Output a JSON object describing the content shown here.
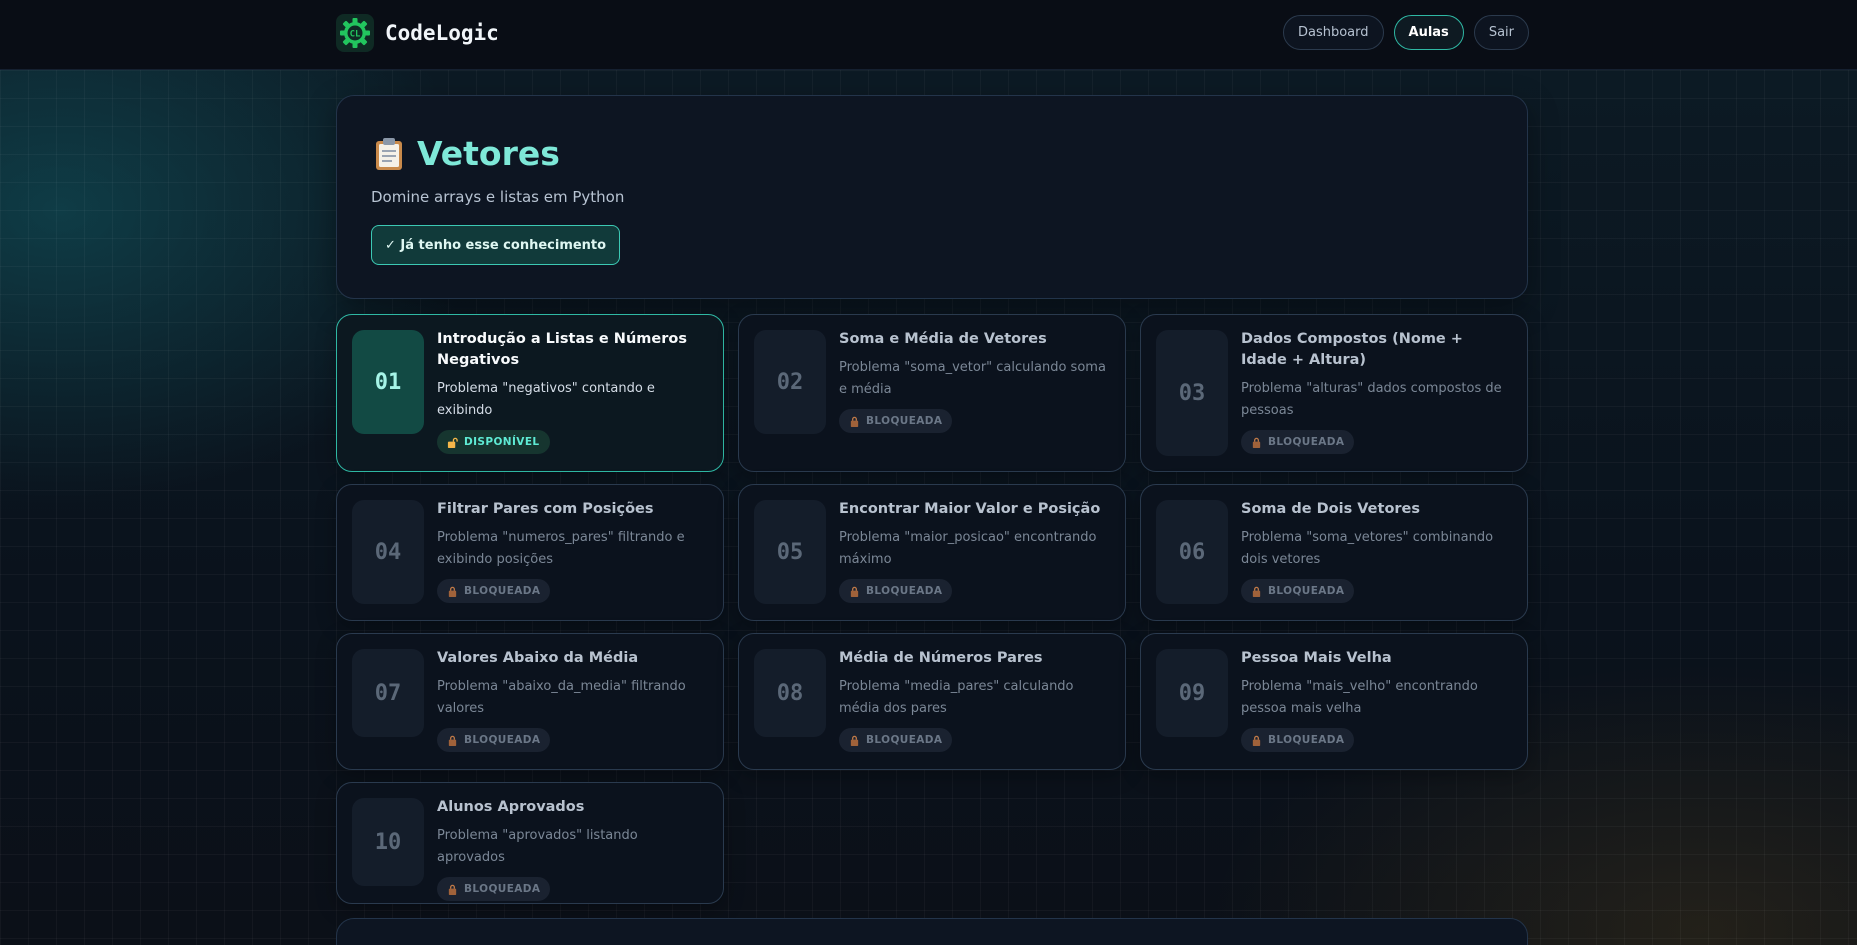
{
  "header": {
    "brand": "CodeLogic",
    "logo_glyph": "CL",
    "nav": [
      {
        "label": "Dashboard",
        "active": false
      },
      {
        "label": "Aulas",
        "active": true
      },
      {
        "label": "Sair",
        "active": false
      }
    ]
  },
  "hero": {
    "icon": "clipboard-icon",
    "title": "Vetores",
    "subtitle": "Domine arrays e listas em Python",
    "known_button": "✓ Já tenho esse conhecimento"
  },
  "lessons": [
    {
      "number": "01",
      "title": "Introdução a Listas e Números Negativos",
      "description": "Problema \"negativos\" contando e exibindo",
      "status": "DISPONÍVEL",
      "available": true
    },
    {
      "number": "02",
      "title": "Soma e Média de Vetores",
      "description": "Problema \"soma_vetor\" calculando soma e média",
      "status": "BLOQUEADA",
      "available": false
    },
    {
      "number": "03",
      "title": "Dados Compostos (Nome + Idade + Altura)",
      "description": "Problema \"alturas\" dados compostos de pessoas",
      "status": "BLOQUEADA",
      "available": false
    },
    {
      "number": "04",
      "title": "Filtrar Pares com Posições",
      "description": "Problema \"numeros_pares\" filtrando e exibindo posições",
      "status": "BLOQUEADA",
      "available": false
    },
    {
      "number": "05",
      "title": "Encontrar Maior Valor e Posição",
      "description": "Problema \"maior_posicao\" encontrando máximo",
      "status": "BLOQUEADA",
      "available": false
    },
    {
      "number": "06",
      "title": "Soma de Dois Vetores",
      "description": "Problema \"soma_vetores\" combinando dois vetores",
      "status": "BLOQUEADA",
      "available": false
    },
    {
      "number": "07",
      "title": "Valores Abaixo da Média",
      "description": "Problema \"abaixo_da_media\" filtrando valores",
      "status": "BLOQUEADA",
      "available": false
    },
    {
      "number": "08",
      "title": "Média de Números Pares",
      "description": "Problema \"media_pares\" calculando média dos pares",
      "status": "BLOQUEADA",
      "available": false
    },
    {
      "number": "09",
      "title": "Pessoa Mais Velha",
      "description": "Problema \"mais_velho\" encontrando pessoa mais velha",
      "status": "BLOQUEADA",
      "available": false
    },
    {
      "number": "10",
      "title": "Alunos Aprovados",
      "description": "Problema \"aprovados\" listando aprovados",
      "status": "BLOQUEADA",
      "available": false
    }
  ],
  "colors": {
    "accent": "#2fb8a4",
    "accent_text": "#7ee8d8",
    "background": "#0a0f18",
    "card": "#0b121d",
    "available_badge": "#5eead4",
    "locked_badge": "#6b7787"
  }
}
